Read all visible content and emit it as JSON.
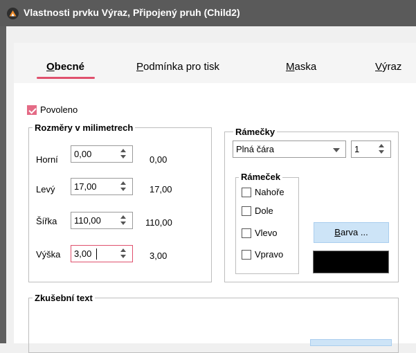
{
  "window": {
    "title": "Vlastnosti prvku Výraz, Připojený pruh (Child2)"
  },
  "tabs": [
    {
      "label_ul": "O",
      "label_rest": "becné",
      "active": true
    },
    {
      "label_ul": "P",
      "label_rest": "odmínka pro tisk",
      "active": false
    },
    {
      "label_ul": "M",
      "label_rest": "aska",
      "active": false
    },
    {
      "label_ul": "V",
      "label_rest": "ýraz",
      "active": false
    }
  ],
  "enabled": {
    "label": "Povoleno",
    "checked": true
  },
  "dimensions": {
    "legend": "Rozměry v milimetrech",
    "rows": [
      {
        "label": "Horní",
        "value": "0,00",
        "readout": "0,00"
      },
      {
        "label": "Levý",
        "value": "17,00",
        "readout": "17,00"
      },
      {
        "label": "Šířka",
        "value": "110,00",
        "readout": "110,00"
      },
      {
        "label": "Výška",
        "value": "3,00",
        "readout": "3,00"
      }
    ]
  },
  "borders": {
    "legend": "Rámečky",
    "style": "Plná čára",
    "width": "1",
    "frame": {
      "legend": "Rámeček",
      "options": [
        {
          "label": "Nahoře",
          "checked": false
        },
        {
          "label": "Dole",
          "checked": false
        },
        {
          "label": "Vlevo",
          "checked": false
        },
        {
          "label": "Vpravo",
          "checked": false
        }
      ]
    },
    "color_button": "Barva ...",
    "color_button_ul": "B",
    "color_button_rest": "arva ...",
    "color": "#000000"
  },
  "sample_text": {
    "legend": "Zkušební text"
  },
  "colors": {
    "accent": "#e0506d",
    "titlebar": "#5a5a5a",
    "button": "#cde4f7"
  }
}
